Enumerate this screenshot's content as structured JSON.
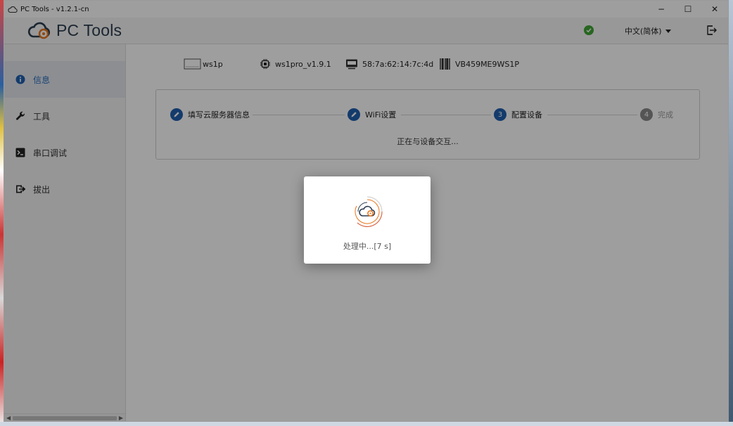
{
  "window": {
    "title": "PC Tools - v1.2.1-cn",
    "controls": {
      "minimize": "−",
      "maximize": "☐",
      "close": "✕"
    }
  },
  "appbar": {
    "logo_text": "PC Tools",
    "language": "中文(简体)"
  },
  "sidebar": {
    "items": [
      {
        "label": "信息",
        "icon": "info-icon",
        "active": true
      },
      {
        "label": "工具",
        "icon": "wrench-icon",
        "active": false
      },
      {
        "label": "串口调试",
        "icon": "terminal-icon",
        "active": false
      },
      {
        "label": "拔出",
        "icon": "eject-icon",
        "active": false
      }
    ]
  },
  "device": {
    "name": "ws1p",
    "firmware": "ws1pro_v1.9.1",
    "mac": "58:7a:62:14:7c:4d",
    "serial": "VB459ME9WS1P"
  },
  "steps": {
    "items": [
      {
        "number": "",
        "label": "填写云服务器信息",
        "state": "done"
      },
      {
        "number": "",
        "label": "WiFi设置",
        "state": "done"
      },
      {
        "number": "3",
        "label": "配置设备",
        "state": "active"
      },
      {
        "number": "4",
        "label": "完成",
        "state": "pending"
      }
    ],
    "status_text": "正在与设备交互..."
  },
  "dialog": {
    "text": "处理中...[7 s]"
  },
  "colors": {
    "accent": "#1f5fae",
    "online": "#3fa535",
    "sidebar_active_bg": "#e3e6ec"
  }
}
